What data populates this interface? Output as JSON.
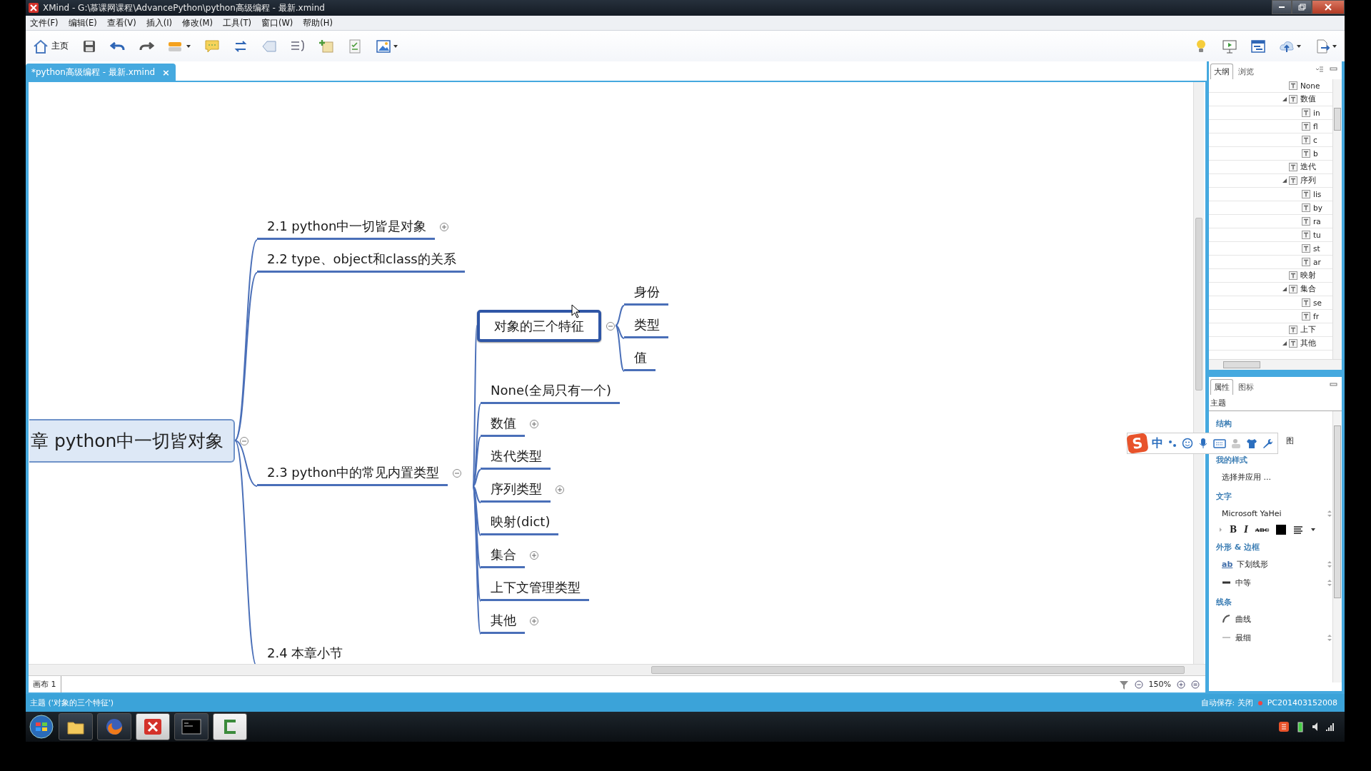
{
  "window": {
    "title": "XMind - G:\\慕课网课程\\AdvancePython\\python高级编程 - 最新.xmind"
  },
  "menu": [
    "文件(F)",
    "编辑(E)",
    "查看(V)",
    "插入(I)",
    "修改(M)",
    "工具(T)",
    "窗口(W)",
    "帮助(H)"
  ],
  "toolbar": {
    "home_label": "主页"
  },
  "editor_tab": {
    "title": "*python高级编程 - 最新.xmind",
    "close": "×"
  },
  "mind_map": {
    "central": {
      "label": "章 python中一切皆对象",
      "expanded": true,
      "selected": false,
      "children": [
        {
          "label": "2.1 python中一切皆是对象",
          "expanded": false,
          "selected": false
        },
        {
          "label": "2.2 type、object和class的关系",
          "selected": false
        },
        {
          "label": "2.3 python中的常见内置类型",
          "expanded": true,
          "selected": false,
          "children": [
            {
              "label": "对象的三个特征",
              "expanded": true,
              "selected": true,
              "children": [
                {
                  "label": "身份",
                  "selected": false
                },
                {
                  "label": "类型",
                  "selected": false
                },
                {
                  "label": "值",
                  "selected": false
                }
              ]
            },
            {
              "label": "None(全局只有一个)",
              "selected": false
            },
            {
              "label": "数值",
              "expanded": false,
              "selected": false
            },
            {
              "label": "迭代类型",
              "selected": false
            },
            {
              "label": "序列类型",
              "expanded": false,
              "selected": false
            },
            {
              "label": "映射(dict)",
              "selected": false
            },
            {
              "label": "集合",
              "expanded": false,
              "selected": false
            },
            {
              "label": "上下文管理类型",
              "selected": false
            },
            {
              "label": "其他",
              "expanded": false,
              "selected": false
            }
          ]
        },
        {
          "label": "2.4 本章小节",
          "selected": false
        }
      ]
    }
  },
  "sheet_tab": {
    "label": "画布 1",
    "selected": true
  },
  "zoom": "150%",
  "outline": {
    "tabs": [
      {
        "label": "大纲",
        "selected": true
      },
      {
        "label": "浏览",
        "selected": false
      }
    ],
    "items": [
      {
        "label": "None"
      },
      {
        "label": "数值",
        "expanded": true,
        "children": [
          {
            "label": "in"
          },
          {
            "label": "fl"
          },
          {
            "label": "c"
          },
          {
            "label": "b"
          }
        ]
      },
      {
        "label": "迭代"
      },
      {
        "label": "序列",
        "expanded": true,
        "children": [
          {
            "label": "lis"
          },
          {
            "label": "by"
          },
          {
            "label": "ra"
          },
          {
            "label": "tu"
          },
          {
            "label": "st"
          },
          {
            "label": "ar"
          }
        ]
      },
      {
        "label": "映射"
      },
      {
        "label": "集合",
        "expanded": true,
        "children": [
          {
            "label": "se"
          },
          {
            "label": "fr"
          }
        ]
      },
      {
        "label": "上下"
      },
      {
        "label": "其他",
        "expanded": true
      }
    ]
  },
  "properties": {
    "tabs": [
      {
        "label": "属性",
        "selected": true
      },
      {
        "label": "图标",
        "selected": false
      }
    ],
    "title": "主题",
    "sections": [
      {
        "heading": "结构",
        "rows": [
          {
            "kind": "partial",
            "label": "图"
          }
        ]
      },
      {
        "heading": "我的样式",
        "rows": [
          {
            "kind": "text",
            "label": "选择并应用 ..."
          }
        ]
      },
      {
        "heading": "文字",
        "rows": [
          {
            "kind": "select",
            "label": "Microsoft YaHei"
          },
          {
            "kind": "format",
            "buttons": [
              "B",
              "I",
              "ABC"
            ],
            "color": "#000000"
          }
        ]
      },
      {
        "heading": "外形 & 边框",
        "rows": [
          {
            "kind": "shape",
            "icon_text": "ab",
            "label": "下划线形"
          },
          {
            "kind": "weight",
            "label": "中等"
          }
        ]
      },
      {
        "heading": "线条",
        "rows": [
          {
            "kind": "curve",
            "label": "曲线"
          },
          {
            "kind": "thin",
            "label": "最细"
          }
        ]
      }
    ]
  },
  "ime_bar": {
    "logo": "S",
    "mode": "中"
  },
  "status_bar": {
    "left": "主题 ('对象的三个特征')",
    "autosave": "自动保存: 关闭",
    "computer": "PC201403152008"
  }
}
